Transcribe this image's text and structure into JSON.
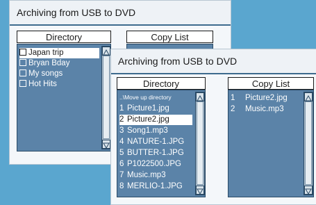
{
  "back_window": {
    "title": "Archiving from USB to DVD",
    "directory_header": "Directory",
    "copylist_header": "Copy List",
    "directory_items": [
      "Japan trip",
      "Bryan Bday",
      "My songs",
      "Hot Hits"
    ],
    "selected_index": 0
  },
  "front_window": {
    "title": "Archiving from USB to DVD",
    "directory_header": "Directory",
    "copylist_header": "Copy List",
    "move_up_label": "..\\Move up directory",
    "directory_items": [
      {
        "num": "1",
        "name": "Picture1.jpg"
      },
      {
        "num": "2",
        "name": "Picture2.jpg"
      },
      {
        "num": "3",
        "name": "Song1.mp3"
      },
      {
        "num": "4",
        "name": "NATURE-1.JPG"
      },
      {
        "num": "5",
        "name": "BUTTER-1.JPG"
      },
      {
        "num": "6",
        "name": "P1022500.JPG"
      },
      {
        "num": "7",
        "name": "Music.mp3"
      },
      {
        "num": "8",
        "name": "MERLIO-1.JPG"
      }
    ],
    "selected_index": 1,
    "copy_list": [
      {
        "num": "1",
        "name": "Picture2.jpg"
      },
      {
        "num": "2",
        "name": "Music.mp3"
      }
    ]
  },
  "icons": {
    "scroll_up": "up-arrow-icon",
    "scroll_down": "down-arrow-icon",
    "checkbox": "checkbox-icon"
  },
  "colors": {
    "background": "#5aa6cf",
    "panel": "#5b83a8",
    "accent_line": "#3d6b8e"
  }
}
